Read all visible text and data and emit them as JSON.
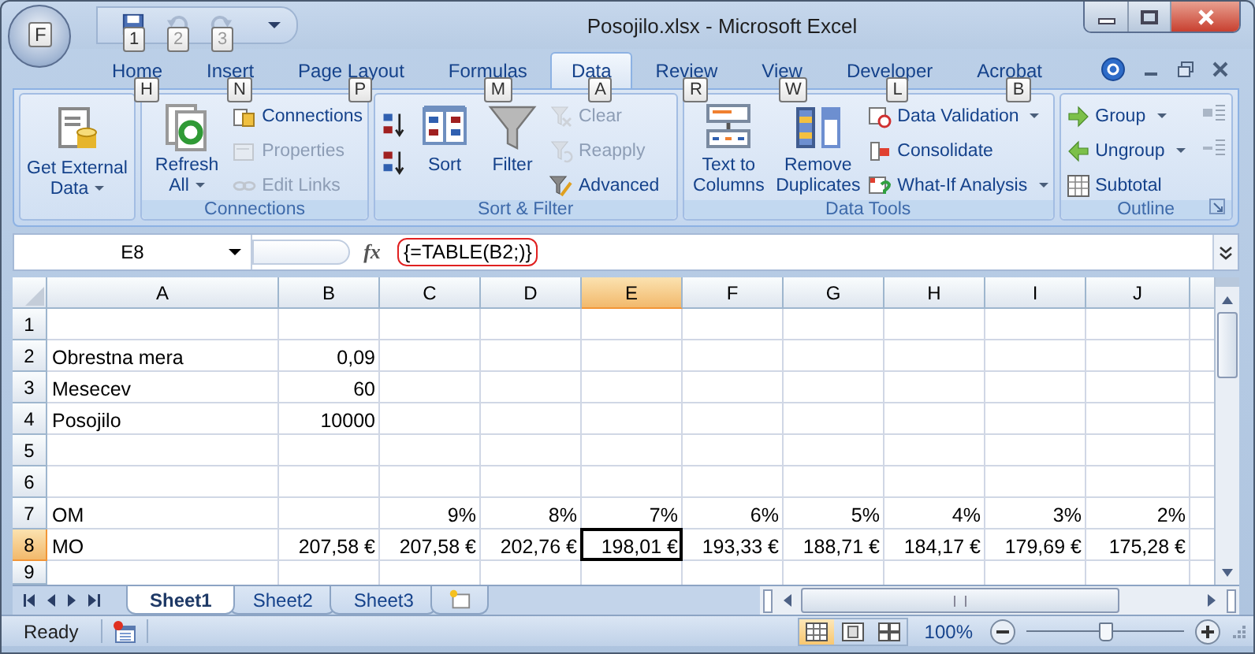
{
  "window": {
    "title": "Posojilo.xlsx - Microsoft Excel"
  },
  "office_button": {
    "keytip": "F"
  },
  "quick_access": [
    {
      "keytip": "1",
      "disabled": false
    },
    {
      "keytip": "2",
      "disabled": true
    },
    {
      "keytip": "3",
      "disabled": true
    }
  ],
  "tabs": [
    {
      "label": "Home",
      "keytip": "H",
      "selected": false
    },
    {
      "label": "Insert",
      "keytip": "N",
      "selected": false
    },
    {
      "label": "Page Layout",
      "keytip": "P",
      "selected": false
    },
    {
      "label": "Formulas",
      "keytip": "M",
      "selected": false
    },
    {
      "label": "Data",
      "keytip": "A",
      "selected": true
    },
    {
      "label": "Review",
      "keytip": "R",
      "selected": false
    },
    {
      "label": "View",
      "keytip": "W",
      "selected": false
    },
    {
      "label": "Developer",
      "keytip": "L",
      "selected": false
    },
    {
      "label": "Acrobat",
      "keytip": "B",
      "selected": false
    }
  ],
  "ribbon": {
    "groups": [
      {
        "items": [
          {
            "kind": "large",
            "label": "Get External Data",
            "dropdown": true,
            "disabled": false
          }
        ]
      },
      {
        "items": [
          {
            "kind": "large",
            "label": "Refresh All",
            "dropdown": true,
            "disabled": false
          },
          {
            "kind": "small",
            "label": "Connections",
            "dropdown": false,
            "disabled": false
          },
          {
            "kind": "small",
            "label": "Properties",
            "dropdown": false,
            "disabled": true
          },
          {
            "kind": "small",
            "label": "Edit Links",
            "dropdown": false,
            "disabled": true
          }
        ],
        "title": "Connections"
      },
      {
        "title": "Sort & Filter",
        "items": [
          {
            "kind": "large",
            "label": "Sort",
            "dropdown": false,
            "disabled": false
          },
          {
            "kind": "large",
            "label": "Filter",
            "dropdown": false,
            "disabled": false
          },
          {
            "kind": "small",
            "label": "Clear",
            "dropdown": false,
            "disabled": true
          },
          {
            "kind": "small",
            "label": "Reapply",
            "dropdown": false,
            "disabled": true
          },
          {
            "kind": "small",
            "label": "Advanced",
            "dropdown": false,
            "disabled": false
          }
        ]
      },
      {
        "title": "Data Tools",
        "items": [
          {
            "kind": "large",
            "label": "Text to Columns",
            "dropdown": false,
            "disabled": false
          },
          {
            "kind": "large",
            "label": "Remove Duplicates",
            "dropdown": false,
            "disabled": false
          },
          {
            "kind": "small",
            "label": "Data Validation",
            "dropdown": true,
            "disabled": false
          },
          {
            "kind": "small",
            "label": "Consolidate",
            "dropdown": false,
            "disabled": false
          },
          {
            "kind": "small",
            "label": "What-If Analysis",
            "dropdown": true,
            "disabled": false
          }
        ]
      },
      {
        "title": "Outline",
        "items": [
          {
            "kind": "small",
            "label": "Group",
            "dropdown": true,
            "disabled": false
          },
          {
            "kind": "small",
            "label": "Ungroup",
            "dropdown": true,
            "disabled": false
          },
          {
            "kind": "small",
            "label": "Subtotal",
            "dropdown": false,
            "disabled": false
          }
        ]
      }
    ]
  },
  "formula_bar": {
    "name_box": "E8",
    "function_label": "fx",
    "formula": "{=TABLE(B2;)}",
    "highlighted": true
  },
  "sheet": {
    "columns": [
      {
        "label": "A",
        "selected": false
      },
      {
        "label": "B",
        "selected": false
      },
      {
        "label": "C",
        "selected": false
      },
      {
        "label": "D",
        "selected": false
      },
      {
        "label": "E",
        "selected": true
      },
      {
        "label": "F",
        "selected": false
      },
      {
        "label": "G",
        "selected": false
      },
      {
        "label": "H",
        "selected": false
      },
      {
        "label": "I",
        "selected": false
      },
      {
        "label": "J",
        "selected": false
      }
    ],
    "rows": [
      {
        "header": "1",
        "selected": false
      },
      {
        "header": "2",
        "selected": false,
        "cells": {
          "A": "Obrestna mera",
          "B": "0,09"
        }
      },
      {
        "header": "3",
        "selected": false,
        "cells": {
          "A": "Mesecev",
          "B": "60"
        }
      },
      {
        "header": "4",
        "selected": false,
        "cells": {
          "A": "Posojilo",
          "B": "10000"
        }
      },
      {
        "header": "5",
        "selected": false
      },
      {
        "header": "6",
        "selected": false
      },
      {
        "header": "7",
        "selected": false,
        "cells": {
          "A": "OM",
          "C": "9%",
          "D": "8%",
          "E": "7%",
          "F": "6%",
          "G": "5%",
          "H": "4%",
          "I": "3%",
          "J": "2%"
        }
      },
      {
        "header": "8",
        "selected": true,
        "cells": {
          "A": "MO",
          "B": "207,58 €",
          "C": "207,58 €",
          "D": "202,76 €",
          "E": "198,01 €",
          "F": "193,33 €",
          "G": "188,71 €",
          "H": "184,17 €",
          "I": "179,69 €",
          "J": "175,28 €"
        }
      },
      {
        "header": "9",
        "selected": false
      }
    ]
  },
  "sheet_tabs": [
    {
      "label": "Sheet1",
      "selected": true
    },
    {
      "label": "Sheet2",
      "selected": false
    },
    {
      "label": "Sheet3",
      "selected": false
    }
  ],
  "status_bar": {
    "status": "Ready",
    "views": [
      {
        "selected": true
      },
      {
        "selected": false
      },
      {
        "selected": false
      }
    ],
    "zoom": "100%",
    "zoom_slider": {
      "level": 0.5
    }
  }
}
